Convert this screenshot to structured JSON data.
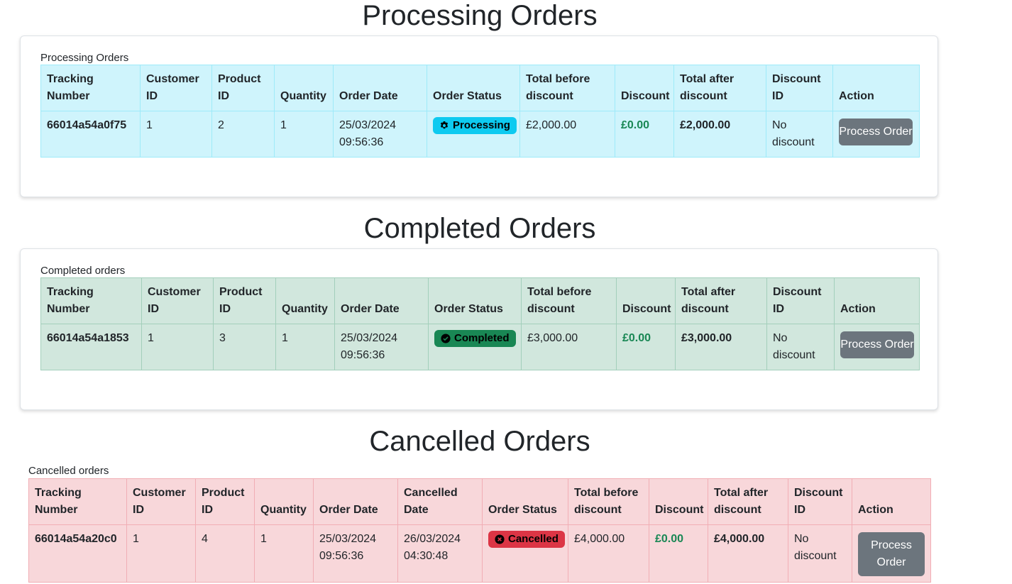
{
  "processing": {
    "title": "Processing Orders",
    "caption": "Processing Orders",
    "headers": [
      "Tracking Number",
      "Customer ID",
      "Product ID",
      "Quantity",
      "Order Date",
      "Order Status",
      "Total before discount",
      "Discount",
      "Total after discount",
      "Discount ID",
      "Action"
    ],
    "row": {
      "tracking": "66014a54a0f75",
      "customer_id": "1",
      "product_id": "2",
      "quantity": "1",
      "order_date": "25/03/2024 09:56:36",
      "status": "Processing",
      "status_icon": "gear-icon",
      "total_before": "£2,000.00",
      "discount": "£0.00",
      "total_after": "£2,000.00",
      "discount_id": "No discount",
      "action": "Process Order"
    }
  },
  "completed": {
    "title": "Completed Orders",
    "caption": "Completed orders",
    "headers": [
      "Tracking Number",
      "Customer ID",
      "Product ID",
      "Quantity",
      "Order Date",
      "Order Status",
      "Total before discount",
      "Discount",
      "Total after discount",
      "Discount ID",
      "Action"
    ],
    "row": {
      "tracking": "66014a54a1853",
      "customer_id": "1",
      "product_id": "3",
      "quantity": "1",
      "order_date": "25/03/2024 09:56:36",
      "status": "Completed",
      "status_icon": "check-circle-icon",
      "total_before": "£3,000.00",
      "discount": "£0.00",
      "total_after": "£3,000.00",
      "discount_id": "No discount",
      "action": "Process Order"
    }
  },
  "cancelled": {
    "title": "Cancelled Orders",
    "caption": "Cancelled orders",
    "headers": [
      "Tracking Number",
      "Customer ID",
      "Product ID",
      "Quantity",
      "Order Date",
      "Cancelled Date",
      "Order Status",
      "Total before discount",
      "Discount",
      "Total after discount",
      "Discount ID",
      "Action"
    ],
    "row": {
      "tracking": "66014a54a20c0",
      "customer_id": "1",
      "product_id": "4",
      "quantity": "1",
      "order_date": "25/03/2024 09:56:36",
      "cancelled_date": "26/03/2024 04:30:48",
      "status": "Cancelled",
      "status_icon": "x-circle-icon",
      "total_before": "£4,000.00",
      "discount": "£0.00",
      "total_after": "£4,000.00",
      "discount_id": "No discount",
      "action": "Process Order"
    }
  },
  "colors": {
    "info_bg": "#cff4fc",
    "success_bg": "#d1e7dd",
    "danger_bg": "#f8d7da",
    "badge_info": "#0dcaf0",
    "badge_success": "#198754",
    "badge_danger": "#dc3545",
    "discount_text": "#198754",
    "button": "#6c757d"
  }
}
